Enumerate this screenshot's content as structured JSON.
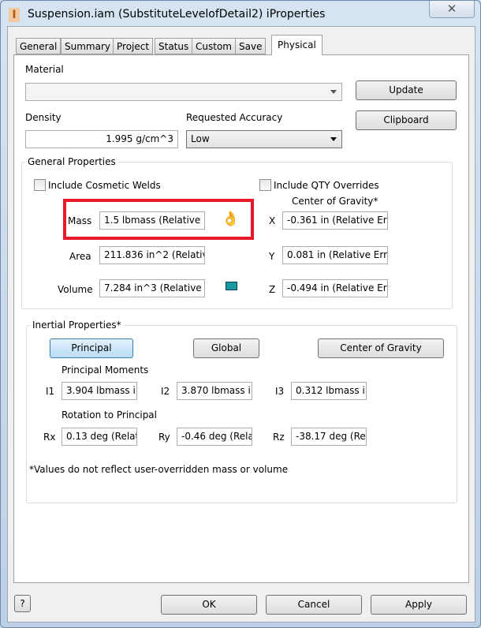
{
  "window": {
    "title": "Suspension.iam (SubstituteLevelofDetail2) iProperties",
    "close": "✕"
  },
  "tabs": [
    "General",
    "Summary",
    "Project",
    "Status",
    "Custom",
    "Save",
    "Physical"
  ],
  "physical": {
    "material_label": "Material",
    "material_value": "",
    "update": "Update",
    "clipboard": "Clipboard",
    "density_label": "Density",
    "density_value": "1.995 g/cm^3",
    "accuracy_label": "Requested Accuracy",
    "accuracy_value": "Low",
    "general": {
      "title": "General Properties",
      "cosmetic_welds": "Include Cosmetic Welds",
      "qty_overrides": "Include QTY Overrides",
      "cog_title": "Center of Gravity*",
      "mass_label": "Mass",
      "mass": "1.5 lbmass (Relative E",
      "area_label": "Area",
      "area": "211.836 in^2 (Relative",
      "volume_label": "Volume",
      "volume": "7.284 in^3 (Relative E",
      "x_label": "X",
      "x": "-0.361 in (Relative Err",
      "y_label": "Y",
      "y": "0.081 in (Relative Erro",
      "z_label": "Z",
      "z": "-0.494 in (Relative Err"
    },
    "inertial": {
      "title": "Inertial Properties*",
      "principal": "Principal",
      "global": "Global",
      "cog": "Center of Gravity",
      "moments_label": "Principal Moments",
      "i1_label": "I1",
      "i1": "3.904 lbmass ir",
      "i2_label": "I2",
      "i2": "3.870 lbmass ir",
      "i3_label": "I3",
      "i3": "0.312 lbmass ir",
      "rotation_label": "Rotation to Principal",
      "rx_label": "Rx",
      "rx": "0.13 deg (Relat",
      "ry_label": "Ry",
      "ry": "-0.46 deg (Rela",
      "rz_label": "Rz",
      "rz": "-38.17 deg (Re",
      "note": "*Values do not reflect user-overridden mass or volume"
    }
  },
  "footer": {
    "help": "?",
    "ok": "OK",
    "cancel": "Cancel",
    "apply": "Apply"
  },
  "colors": {
    "highlight": "#e8192c"
  }
}
